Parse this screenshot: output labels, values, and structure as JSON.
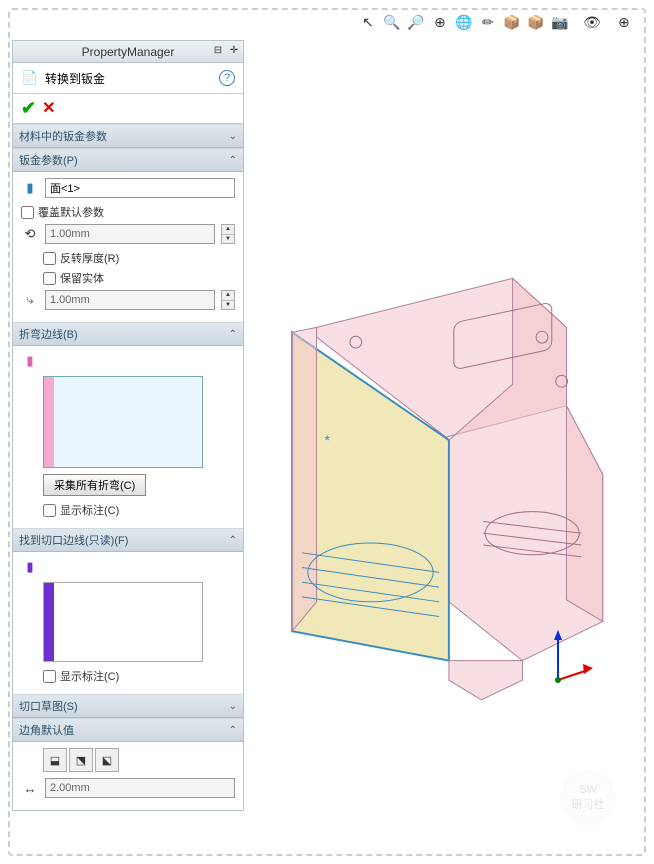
{
  "top_toolbar": {
    "items": [
      "↖",
      "🔍",
      "🔎",
      "⊕",
      "🌐",
      "✏",
      "📦",
      "📦",
      "📷",
      "·",
      "👁",
      "·",
      "⊕",
      "·"
    ]
  },
  "panel": {
    "title": "PropertyManager",
    "feature_title": "转换到钣金",
    "help": "?",
    "ok": "✔",
    "cancel": "✕",
    "sections": {
      "mat": {
        "title": "材料中的钣金参数",
        "collapsed": true
      },
      "params": {
        "title": "钣金参数(P)",
        "face_value": "面<1>",
        "override": "覆盖默认参数",
        "thickness": "1.00mm",
        "reverse": "反转厚度(R)",
        "keep_body": "保留实体",
        "bend_radius": "1.00mm"
      },
      "bends": {
        "title": "折弯边线(B)",
        "collect_btn": "采集所有折弯(C)",
        "show_callout": "显示标注(C)"
      },
      "rips": {
        "title": "找到切口边线(只读)(F)",
        "show_callout": "显示标注(C)"
      },
      "sketch": {
        "title": "切口草图(S)"
      },
      "corners": {
        "title": "边角默认值",
        "gap": "2.00mm"
      }
    }
  },
  "watermark": {
    "line1": "SW",
    "line2": "研习社"
  }
}
